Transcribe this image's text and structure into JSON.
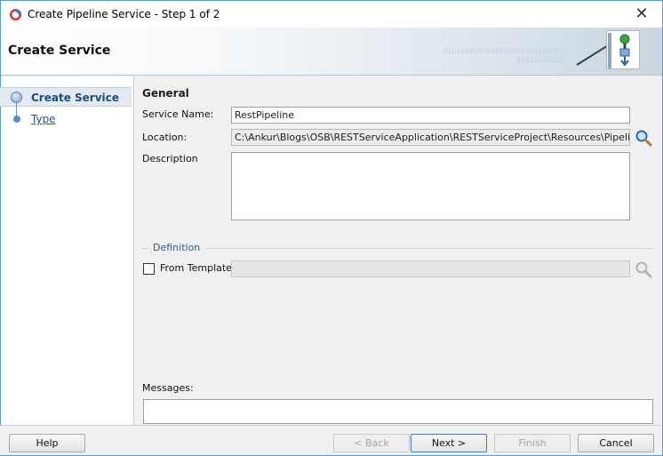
{
  "window": {
    "title": "Create Pipeline Service - Step 1 of 2",
    "close_glyph": "✕"
  },
  "banner": {
    "title": "Create Service",
    "binary_text": "0101010101010101010101010101",
    "binary_text2": "01010101010"
  },
  "sidebar": {
    "steps": [
      {
        "label": "Create Service",
        "active": true
      },
      {
        "label": "Type",
        "active": false
      }
    ]
  },
  "form": {
    "section_title": "General",
    "service_name_label": "Service Name:",
    "service_name_value": "RestPipeline",
    "location_label": "Location:",
    "location_value": "C:\\Ankur\\Blogs\\OSB\\RESTServiceApplication\\RESTServiceProject\\Resources\\Pipeline",
    "description_label": "Description",
    "description_value": ""
  },
  "definition": {
    "title": "Definition",
    "from_template_label": "From Template",
    "from_template_checked": false,
    "template_value": ""
  },
  "messages": {
    "label": "Messages:",
    "value": ""
  },
  "footer": {
    "help": "Help",
    "back": "< Back",
    "next": "Next >",
    "finish": "Finish",
    "cancel": "Cancel"
  },
  "icons": {
    "app": "oracle-logo-icon",
    "search": "magnifier-icon",
    "wizard": "pipeline-wizard-icon"
  },
  "colors": {
    "accent": "#1a5a9a",
    "window_border": "#5b9bd5"
  }
}
